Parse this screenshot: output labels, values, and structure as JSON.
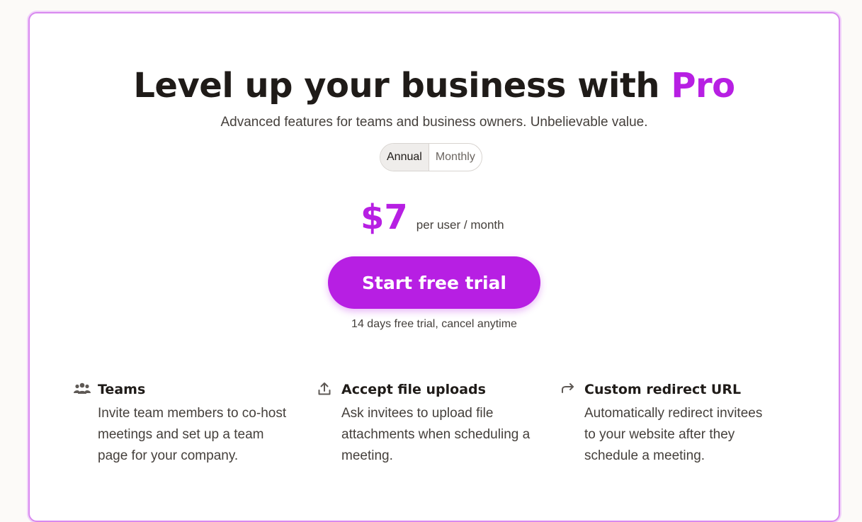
{
  "header": {
    "title_main": "Level up your business with",
    "title_highlight": "Pro",
    "subtitle": "Advanced features for teams and business owners. Unbelievable value."
  },
  "billing_toggle": {
    "annual_label": "Annual",
    "monthly_label": "Monthly",
    "selected": "Annual"
  },
  "pricing": {
    "price": "$7",
    "unit": "per user / month"
  },
  "cta": {
    "label": "Start free trial",
    "note": "14 days free trial, cancel anytime"
  },
  "features": [
    {
      "icon": "users-icon",
      "title": "Teams",
      "description": "Invite team members to co-host meetings and set up a team page for your company."
    },
    {
      "icon": "upload-icon",
      "title": "Accept file uploads",
      "description": "Ask invitees to upload file attachments when scheduling a meeting."
    },
    {
      "icon": "redirect-arrow-icon",
      "title": "Custom redirect URL",
      "description": "Automatically redirect invitees to your website after they schedule a meeting."
    }
  ],
  "colors": {
    "accent": "#b71fe3",
    "border": "#d889ef",
    "text": "#1f1b18",
    "muted_text": "#45403c"
  }
}
